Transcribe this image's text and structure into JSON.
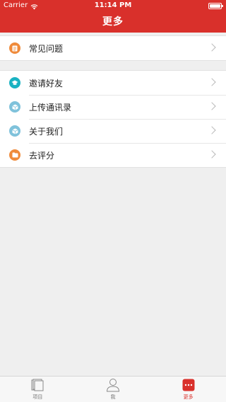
{
  "status": {
    "carrier": "Carrier",
    "time": "11:14 PM",
    "battery_level": 1.0
  },
  "header": {
    "title": "更多"
  },
  "groups": [
    {
      "items": [
        {
          "label": "常见问题",
          "icon": "document-icon",
          "color": "#ef8a3a"
        }
      ]
    },
    {
      "items": [
        {
          "label": "邀请好友",
          "icon": "graduation-cap-icon",
          "color": "#19b2c2"
        },
        {
          "label": "上传通讯录",
          "icon": "box-icon",
          "color": "#7fc2db"
        },
        {
          "label": "关于我们",
          "icon": "box-icon",
          "color": "#7fc2db"
        },
        {
          "label": "去评分",
          "icon": "folder-icon",
          "color": "#ef8a3a"
        }
      ]
    }
  ],
  "tabs": [
    {
      "label": "项目",
      "icon": "stack-icon",
      "active": false
    },
    {
      "label": "我",
      "icon": "person-icon",
      "active": false
    },
    {
      "label": "更多",
      "icon": "more-icon",
      "active": true
    }
  ],
  "colors": {
    "brand": "#d9302b",
    "background": "#efefef"
  }
}
